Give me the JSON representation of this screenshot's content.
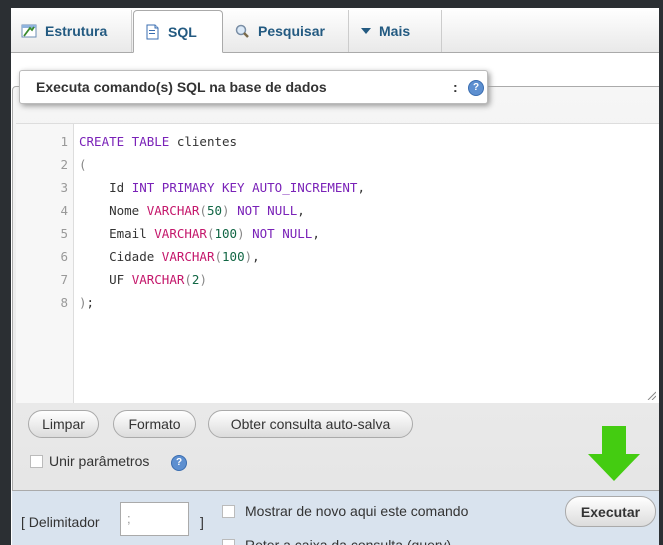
{
  "tabs": [
    {
      "label": "Estrutura",
      "icon": "table-structure-icon"
    },
    {
      "label": "SQL",
      "icon": "sql-document-icon",
      "active": true
    },
    {
      "label": "Pesquisar",
      "icon": "search-icon"
    },
    {
      "label": "Mais",
      "icon": "dropdown-arrow-icon"
    }
  ],
  "legend": {
    "title": "Executa comando(s) SQL na base de dados",
    "colon": ":"
  },
  "editor": {
    "lines": [
      {
        "n": "1",
        "html": "<span class='kw'>CREATE TABLE</span> clientes"
      },
      {
        "n": "2",
        "html": "<span class='p'>(</span>"
      },
      {
        "n": "3",
        "html": "    Id <span class='kw'>INT PRIMARY KEY AUTO_INCREMENT</span>,"
      },
      {
        "n": "4",
        "html": "    Nome <span class='ty'>VARCHAR</span><span class='p'>(</span><span class='num'>50</span><span class='p'>)</span> <span class='kw'>NOT NULL</span>,"
      },
      {
        "n": "5",
        "html": "    Email <span class='ty'>VARCHAR</span><span class='p'>(</span><span class='num'>100</span><span class='p'>)</span> <span class='kw'>NOT NULL</span>,"
      },
      {
        "n": "6",
        "html": "    Cidade <span class='ty'>VARCHAR</span><span class='p'>(</span><span class='num'>100</span><span class='p'>)</span>,"
      },
      {
        "n": "7",
        "html": "    UF <span class='ty'>VARCHAR</span><span class='p'>(</span><span class='num'>2</span><span class='p'>)</span>"
      },
      {
        "n": "8",
        "html": "<span class='p'>)</span>;"
      }
    ]
  },
  "buttons": {
    "limpar": "Limpar",
    "formato": "Formato",
    "obter": "Obter consulta auto-salva",
    "executar": "Executar"
  },
  "options": {
    "unir": "Unir parâmetros",
    "delimitador_label": "[ Delimitador",
    "delimitador_value": ";",
    "delimitador_close": "]",
    "mostrar": "Mostrar de novo aqui este comando",
    "reter": "Reter a caixa da consulta (query)"
  },
  "colors": {
    "accent_link": "#235a81",
    "arrow": "#44cc11"
  }
}
